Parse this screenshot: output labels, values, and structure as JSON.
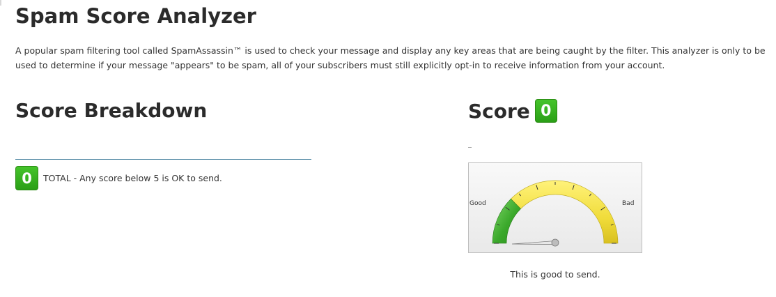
{
  "page": {
    "title": "Spam Score Analyzer",
    "intro": "A popular spam filtering tool called SpamAssassin™ is used to check your message and display any key areas that are being caught by the filter. This analyzer is only to be used to determine if your message \"appears\" to be spam, all of your subscribers must still explicitly opt-in to receive information from your account."
  },
  "breakdown": {
    "title": "Score Breakdown",
    "total_value": "0",
    "total_text": "TOTAL - Any score below 5 is OK to send."
  },
  "score": {
    "title": "Score",
    "value": "0",
    "gauge": {
      "label_good": "Good",
      "label_bad": "Bad",
      "value": 0,
      "min": 0,
      "max": 20,
      "green_until": 5,
      "colors": {
        "good": "#3aa82a",
        "bad": "#f0dc3a"
      }
    },
    "caption": "This is good to send."
  },
  "colors": {
    "badge": "#35b21f",
    "divider": "#3c7a99"
  }
}
